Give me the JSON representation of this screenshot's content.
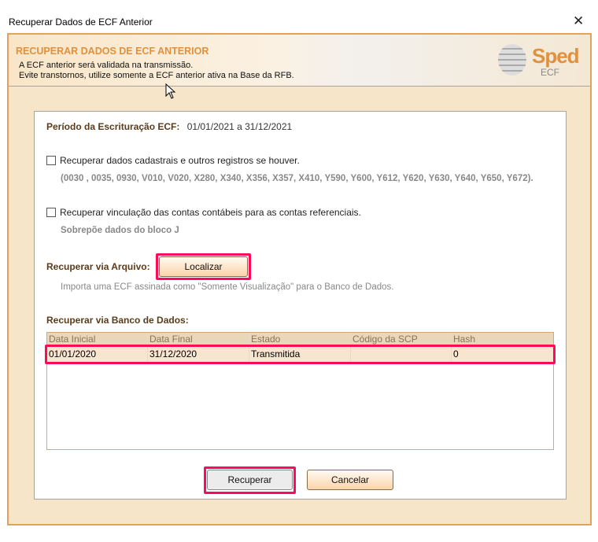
{
  "window": {
    "title": "Recuperar Dados de ECF Anterior",
    "close": "✕"
  },
  "header": {
    "title": "RECUPERAR DADOS DE ECF ANTERIOR",
    "line1": "A ECF anterior será validada na transmissão.",
    "line2": "Evite transtornos, utilize somente a ECF anterior ativa na Base da RFB.",
    "logo_main": "Sped",
    "logo_sub": "ECF"
  },
  "periodo": {
    "label": "Período da Escrituração ECF:",
    "value": "01/01/2021 a 31/12/2021"
  },
  "option1": {
    "label": "Recuperar dados cadastrais e outros registros se houver.",
    "checked": false,
    "detail": "(0030 , 0035, 0930, V010, V020, X280, X340, X356, X357, X410, Y590, Y600, Y612, Y620, Y630, Y640, Y650, Y672)."
  },
  "option2": {
    "label": "Recuperar vinculação das contas contábeis para as contas referenciais.",
    "checked": false,
    "detail": "Sobrepõe dados do bloco J"
  },
  "arquivo": {
    "label": "Recuperar via Arquivo:",
    "button": "Localizar",
    "hint": "Importa uma ECF assinada como \"Somente Visualização\" para o Banco de Dados."
  },
  "banco": {
    "label": "Recuperar via Banco de Dados:",
    "columns": [
      "Data Inicial",
      "Data Final",
      "Estado",
      "Código da SCP",
      "Hash"
    ],
    "rows": [
      [
        "01/01/2020",
        "31/12/2020",
        "Transmitida",
        "",
        "0"
      ]
    ]
  },
  "buttons": {
    "recuperar": "Recuperar",
    "cancelar": "Cancelar"
  }
}
